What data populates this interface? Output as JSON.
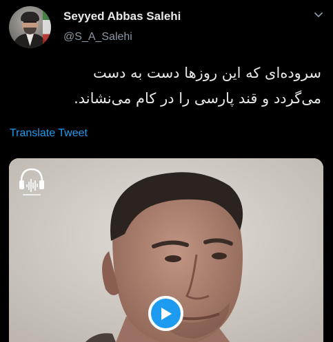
{
  "author": {
    "display_name": "Seyyed Abbas Salehi",
    "handle": "@S_A_Salehi"
  },
  "tweet": {
    "lines": [
      "سروده‌ای که این روزها دست به دست",
      "می‌گردد و قند پارسی را در کام می‌نشاند."
    ],
    "translate_label": "Translate Tweet"
  },
  "media": {
    "type": "video",
    "play_icon": "play-icon",
    "watermark_icon": "headphones-logo-icon"
  },
  "icons": {
    "menu": "chevron-down-icon"
  },
  "colors": {
    "background": "#000000",
    "text_primary": "#e7e9ea",
    "text_secondary": "#8b98a5",
    "accent": "#1d9bf0"
  }
}
